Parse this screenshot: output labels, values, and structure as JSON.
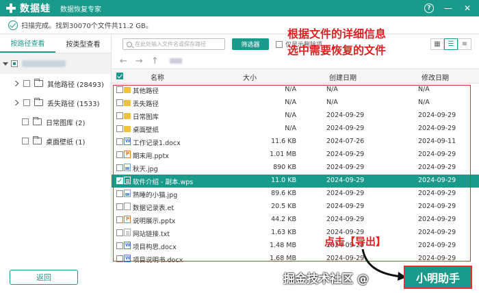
{
  "titlebar": {
    "app_name": "数据蛙",
    "subtitle": "数据恢复专家",
    "help": "?",
    "minimize": "—",
    "close": "✕"
  },
  "status": {
    "text": "扫描完成。找到30070个文件共11.2 GB。"
  },
  "left_tabs": [
    "按路径查看",
    "按类型查看"
  ],
  "tree": [
    {
      "label": "其他路径 (28493)"
    },
    {
      "label": "丢失路径 (1533)"
    },
    {
      "label": "日常图库 (2)"
    },
    {
      "label": "桌面壁纸 (1)"
    }
  ],
  "toolbar": {
    "search_placeholder": "在此处输入文件名或保存路径",
    "filter_label": "筛选器",
    "only_deleted_label": "仅显示删除项"
  },
  "table": {
    "headers": {
      "name": "名称",
      "size": "大小",
      "created": "创建日期",
      "modified": "修改日期"
    },
    "rows": [
      {
        "name": "其他路径",
        "icon": "folder-icon",
        "size": "N/A",
        "created": "N/A",
        "modified": "N/A"
      },
      {
        "name": "丢失路径",
        "icon": "folder-icon",
        "size": "N/A",
        "created": "N/A",
        "modified": "N/A"
      },
      {
        "name": "日常图库",
        "icon": "folder-icon",
        "size": "N/A",
        "created": "2024-09-29",
        "modified": "2024-09-29"
      },
      {
        "name": "桌面壁纸",
        "icon": "folder-icon",
        "size": "N/A",
        "created": "2024-09-29",
        "modified": "2024-09-29"
      },
      {
        "name": "工作记录1.docx",
        "icon": "word-icon",
        "size": "11.6 KB",
        "created": "2024-07-26",
        "modified": "2024-09-11"
      },
      {
        "name": "期末用.pptx",
        "icon": "ppt-icon",
        "size": "1.01 MB",
        "created": "2024-09-29",
        "modified": "2024-09-29"
      },
      {
        "name": "秋天.jpg",
        "icon": "image-icon",
        "size": "890 KB",
        "created": "2024-09-29",
        "modified": "2024-09-29"
      },
      {
        "name": "软件介绍 - 副本.wps",
        "icon": "wps-icon",
        "size": "11.0 KB",
        "created": "2024-09-29",
        "modified": "2024-09-29",
        "selected": true
      },
      {
        "name": "熟睡的小猫.jpg",
        "icon": "image-icon",
        "size": "89.6 KB",
        "created": "2024-09-29",
        "modified": "2024-09-29"
      },
      {
        "name": "数据记录表.et",
        "icon": "spreadsheet-icon",
        "size": "20.5 KB",
        "created": "2024-09-29",
        "modified": "2024-09-29"
      },
      {
        "name": "说明展示.pptx",
        "icon": "ppt-icon",
        "size": "44.2 KB",
        "created": "2024-09-29",
        "modified": "2024-09-29"
      },
      {
        "name": "网站链接.txt",
        "icon": "text-icon",
        "size": "1.63 KB",
        "created": "2024-09-29",
        "modified": "2024-09-29"
      },
      {
        "name": "项目构思.docx",
        "icon": "word-icon",
        "size": "1.48 MB",
        "created": "2024-09-29",
        "modified": "2024-09-29"
      },
      {
        "name": "项目说明书.docx",
        "icon": "word-icon",
        "size": "1.68 MB",
        "created": "2024-09-29",
        "modified": "2024-09-29"
      }
    ]
  },
  "buttons": {
    "back": "返回",
    "export": "小明助手"
  },
  "annotations": {
    "top_line1": "根据文件的详细信息",
    "top_line2": "选中需要恢复的文件",
    "bottom": "点击【导出】",
    "watermark": "掘金技术社区 @"
  },
  "colors": {
    "accent": "#1a9a8a",
    "annotation": "#e02020"
  }
}
